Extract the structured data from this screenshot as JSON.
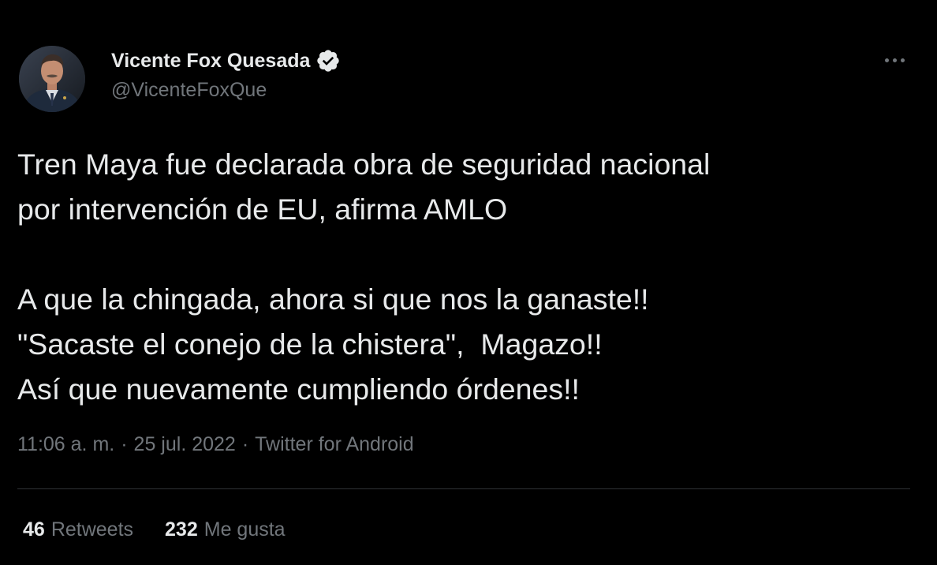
{
  "author": {
    "display_name": "Vicente Fox Quesada",
    "handle": "@VicenteFoxQue",
    "verified": true,
    "avatar_icon": "profile-photo",
    "verified_icon": "verified-badge-icon"
  },
  "menu": {
    "icon": "more-options-icon"
  },
  "tweet": {
    "lines": [
      "Tren Maya fue declarada obra de seguridad nacional",
      "por intervención de EU, afirma AMLO",
      "",
      "A que la chingada, ahora si que nos la ganaste!!",
      "\"Sacaste el conejo de la chistera\",  Magazo!!",
      "Así que nuevamente cumpliendo órdenes!!"
    ]
  },
  "meta": {
    "time": "11:06 a. m.",
    "separator": "·",
    "date": "25 jul. 2022",
    "source": "Twitter for Android"
  },
  "stats": {
    "retweets_count": "46",
    "retweets_label": "Retweets",
    "likes_count": "232",
    "likes_label": "Me gusta"
  },
  "colors": {
    "background": "#000000",
    "primary_text": "#e7e9ea",
    "secondary_text": "#71767b",
    "divider": "#2f3336",
    "badge": "#e7e9ea"
  }
}
